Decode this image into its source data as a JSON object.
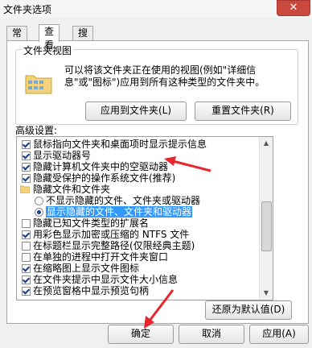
{
  "window": {
    "title": "文件夹选项",
    "close_glyph": "✕"
  },
  "tabs": [
    {
      "label": "常规"
    },
    {
      "label": "查看"
    },
    {
      "label": "搜索"
    }
  ],
  "folder_views": {
    "label": "文件夹视图",
    "description": "可以将该文件夹正在使用的视图(例如\"详细信息\"或\"图标\")应用到所有这种类型的文件夹中。",
    "apply_button": "应用到文件夹(L)",
    "reset_button": "重置文件夹(R)"
  },
  "advanced": {
    "label": "高级设置:",
    "items": [
      {
        "type": "checkbox",
        "checked": true,
        "label": "鼠标指向文件夹和桌面项时显示提示信息"
      },
      {
        "type": "checkbox",
        "checked": true,
        "label": "显示驱动器号"
      },
      {
        "type": "checkbox",
        "checked": true,
        "label": "隐藏计算机文件夹中的空驱动器"
      },
      {
        "type": "checkbox",
        "checked": true,
        "label": "隐藏受保护的操作系统文件(推荐)"
      },
      {
        "type": "folder",
        "label": "隐藏文件和文件夹"
      },
      {
        "type": "radio",
        "checked": false,
        "label": "不显示隐藏的文件、文件夹或驱动器"
      },
      {
        "type": "radio",
        "checked": true,
        "selected": true,
        "label": "显示隐藏的文件、文件夹和驱动器"
      },
      {
        "type": "checkbox",
        "checked": false,
        "label": "隐藏已知文件类型的扩展名"
      },
      {
        "type": "checkbox",
        "checked": true,
        "label": "用彩色显示加密或压缩的 NTFS 文件"
      },
      {
        "type": "checkbox",
        "checked": false,
        "label": "在标题栏显示完整路径(仅限经典主题)"
      },
      {
        "type": "checkbox",
        "checked": false,
        "label": "在单独的进程中打开文件夹窗口"
      },
      {
        "type": "checkbox",
        "checked": true,
        "label": "在缩略图上显示文件图标"
      },
      {
        "type": "checkbox",
        "checked": true,
        "label": "在文件夹提示中显示文件大小信息"
      },
      {
        "type": "checkbox",
        "checked": true,
        "label": "在预览窗格中显示预览句柄"
      }
    ],
    "restore_button": "还原为默认值(D)"
  },
  "dialog_buttons": {
    "ok": "确定",
    "cancel": "取消",
    "apply": "应用(A)"
  },
  "colors": {
    "annotation_arrow": "#e8262d",
    "selection": "#3399ff"
  }
}
